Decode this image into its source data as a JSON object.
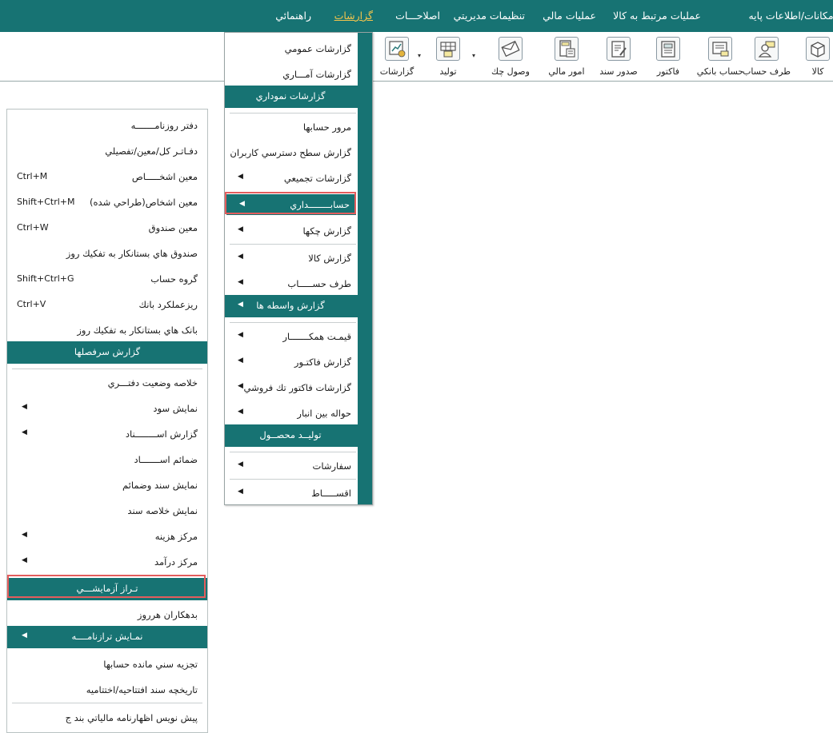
{
  "menubar": {
    "items": [
      {
        "label": "امکانات/اطلاعات پايه"
      },
      {
        "label": "عمليات مرتبط به کالا"
      },
      {
        "label": "عمليات مالي"
      },
      {
        "label": "تنظيمات مديريتي"
      },
      {
        "label": "اصلاحـــات"
      },
      {
        "label": "گزارشات"
      },
      {
        "label": "راهنمائي"
      }
    ],
    "active": "گزارشات"
  },
  "toolbar": {
    "buttons": [
      {
        "label": "کالا",
        "icon": "box-icon"
      },
      {
        "label": "طرف حساب",
        "icon": "person-card-icon"
      },
      {
        "label": "حساب بانکي",
        "icon": "bank-card-icon"
      },
      {
        "label": "فاکتور",
        "icon": "invoice-icon"
      },
      {
        "label": "صدور سند",
        "icon": "document-edit-icon"
      },
      {
        "label": "امور مالي",
        "icon": "calculator-icon"
      },
      {
        "label": "وصول چك",
        "icon": "envelope-check-icon"
      },
      {
        "label": "توليد",
        "icon": "factory-icon"
      },
      {
        "label": "گزارشات",
        "icon": "report-chart-icon"
      }
    ]
  },
  "left_menu": {
    "items": [
      {
        "label": "دفتر روزنامـــــــه"
      },
      {
        "label": "دفـاتـر كل/معين/تفصيلي"
      },
      {
        "label": "معين اشخـــــاص",
        "shortcut": "Ctrl+M"
      },
      {
        "label": "معين اشخاص(طراحي شده)",
        "shortcut": "Shift+Ctrl+M"
      },
      {
        "label": "معين صندوق",
        "shortcut": "Ctrl+W"
      },
      {
        "label": "صندوق هاي بستانكار به تفكيك روز"
      },
      {
        "label": "گروه حساب",
        "shortcut": "Shift+Ctrl+G"
      },
      {
        "label": "ريزعملكرد بانك",
        "shortcut": "Ctrl+V"
      },
      {
        "label": "بانک هاي بستانكار به تفكيك روز"
      },
      {
        "label": "گزارش سرفصلها"
      },
      {
        "label": "خلاصه وضعيت دفتـــري"
      },
      {
        "label": "نمايش سود"
      },
      {
        "label": "گزارش اســــــــناد"
      },
      {
        "label": "ضمائم اســـــــاد"
      },
      {
        "label": "نمايش سند وضمائم"
      },
      {
        "label": "نمايش خلاصه سند"
      },
      {
        "label": "مرکز هزينه"
      },
      {
        "label": "مرکز درآمد"
      },
      {
        "label": "تـراز آزمايشـــي"
      },
      {
        "label": "بدهكاران هرروز"
      },
      {
        "label": "نمـايش ترازنامــــه"
      },
      {
        "label": "تجزيه سني مانده حسابها"
      },
      {
        "label": "تاريخچه سند افتتاحيه/اختتاميه"
      },
      {
        "label": "پيش نويس اظهارنامه مالياتي بند ج"
      }
    ]
  },
  "mid_menu": {
    "items": [
      {
        "label": "گزارشات عمومي"
      },
      {
        "label": "گزارشات آمـــاري"
      },
      {
        "label": "گزارشات نموداري"
      },
      {
        "label": "مرور حسابها"
      },
      {
        "label": "گزارش سطح دسترسي كاربران"
      },
      {
        "label": "گزارشات تجميعي"
      },
      {
        "label": "حسابــــــــداري"
      },
      {
        "label": "گزارش چكها"
      },
      {
        "label": "گزارش كالا"
      },
      {
        "label": "طرف حســـــاب"
      },
      {
        "label": "گزارش واسطه ها"
      },
      {
        "label": "قيمـت همكـــــــار"
      },
      {
        "label": "گزارش فاكتـور"
      },
      {
        "label": "گزارشات فاكتور تك فروشي"
      },
      {
        "label": "حواله بين انبار"
      },
      {
        "label": "توليــد محصــول"
      },
      {
        "label": "سفارشات"
      },
      {
        "label": "اقســـــاط"
      }
    ]
  },
  "colors": {
    "accent": "#177373",
    "active_menu": "#f2c44c",
    "highlight_border": "#e35d5d"
  }
}
